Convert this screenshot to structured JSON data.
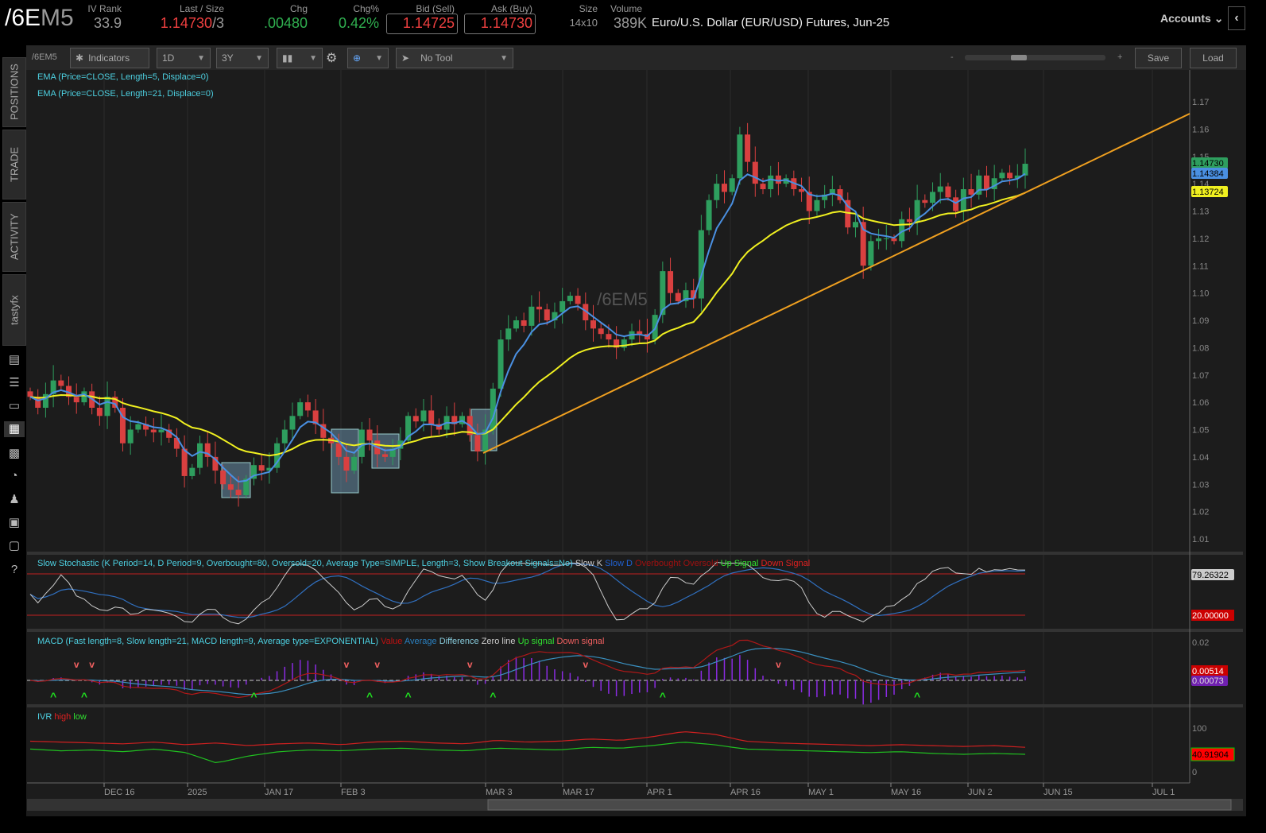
{
  "header": {
    "symbol_main": "/6E",
    "symbol_suffix": "M5",
    "iv_rank_label": "IV Rank",
    "iv_rank": "33.9",
    "last_label": "Last / Size",
    "last": "1.14730",
    "size": "/3",
    "chg_label": "Chg",
    "chg": ".00480",
    "chgpct_label": "Chg%",
    "chgpct": "0.42%",
    "bid_label": "Bid (Sell)",
    "bid": "1.14725",
    "ask_label": "Ask (Buy)",
    "ask": "1.14730",
    "size_label": "Size",
    "size_val": "14x10",
    "volume_label": "Volume",
    "volume": "389K",
    "description": "Euro/U.S. Dollar (EUR/USD) Futures, Jun-25",
    "accounts": "Accounts"
  },
  "sidebar": {
    "tabs": [
      "POSITIONS",
      "TRADE",
      "ACTIVITY",
      "tastyfx"
    ]
  },
  "toolbar": {
    "symbol": "/6EM5",
    "indicators": "Indicators",
    "interval": "1D",
    "range": "3Y",
    "tool": "No Tool",
    "zoom_minus": "-",
    "zoom_plus": "+",
    "save": "Save",
    "load": "Load"
  },
  "studies": {
    "ema5": "EMA (Price=CLOSE, Length=5, Displace=0)",
    "ema21": "EMA (Price=CLOSE, Length=21, Displace=0)",
    "stoch": {
      "title": "Slow Stochastic (K Period=14, D Period=9, Overbought=80, Oversold=20, Average Type=SIMPLE, Length=3, Show Breakout Signals=No)",
      "k": "Slow K",
      "d": "Slow D",
      "ob": "Overbought",
      "os": "Oversold",
      "up": "Up Signal",
      "down": "Down Signal",
      "value": "79.26322",
      "oversold_value": "20.00000"
    },
    "macd": {
      "title": "MACD (Fast length=8, Slow length=21, MACD length=9, Average type=EXPONENTIAL)",
      "value": "Value",
      "avg": "Average",
      "diff": "Difference",
      "zero": "Zero line",
      "up": "Up signal",
      "down": "Down signal",
      "val": "0.00514",
      "diffval": "0.00073",
      "tick": "0.02"
    },
    "ivr": {
      "title": "IVR",
      "high": "high",
      "low": "low",
      "val": "40.91904",
      "t100": "100",
      "t0": "0"
    }
  },
  "price_tags": {
    "last": "1.14730",
    "ema5": "1.14384",
    "ema21": "1.13724"
  },
  "watermark": "/6EM5",
  "chart_data": {
    "type": "candlestick",
    "symbol": "/6EM5",
    "first_date": "Dec 2",
    "last_date": "Jun 10",
    "closes": [
      1.062,
      1.058,
      1.063,
      1.068,
      1.066,
      1.062,
      1.06,
      1.064,
      1.058,
      1.055,
      1.062,
      1.058,
      1.045,
      1.05,
      1.052,
      1.05,
      1.049,
      1.05,
      1.047,
      1.043,
      1.033,
      1.036,
      1.045,
      1.04,
      1.035,
      1.03,
      1.028,
      1.026,
      1.032,
      1.037,
      1.035,
      1.036,
      1.045,
      1.05,
      1.055,
      1.06,
      1.057,
      1.052,
      1.047,
      1.045,
      1.04,
      1.035,
      1.04,
      1.05,
      1.046,
      1.041,
      1.04,
      1.043,
      1.046,
      1.055,
      1.053,
      1.057,
      1.052,
      1.05,
      1.055,
      1.052,
      1.055,
      1.048,
      1.042,
      1.05,
      1.065,
      1.083,
      1.087,
      1.09,
      1.088,
      1.095,
      1.094,
      1.09,
      1.093,
      1.097,
      1.099,
      1.096,
      1.09,
      1.087,
      1.085,
      1.083,
      1.08,
      1.083,
      1.086,
      1.085,
      1.083,
      1.092,
      1.108,
      1.1,
      1.097,
      1.101,
      1.098,
      1.123,
      1.134,
      1.14,
      1.137,
      1.142,
      1.158,
      1.148,
      1.14,
      1.138,
      1.143,
      1.14,
      1.142,
      1.138,
      1.137,
      1.13,
      1.134,
      1.136,
      1.138,
      1.134,
      1.124,
      1.126,
      1.11,
      1.119,
      1.12,
      1.12,
      1.119,
      1.127,
      1.126,
      1.134,
      1.133,
      1.137,
      1.139,
      1.135,
      1.13,
      1.138,
      1.136,
      1.143,
      1.138,
      1.142,
      1.144,
      1.142,
      1.143,
      1.1473
    ],
    "y_ticks": [
      "1.17",
      "1.16",
      "1.15",
      "1.14",
      "1.13",
      "1.12",
      "1.11",
      "1.10",
      "1.09",
      "1.08",
      "1.07",
      "1.06",
      "1.05",
      "1.04",
      "1.03",
      "1.02",
      "1.01"
    ],
    "x_ticks": [
      "DEC 16",
      "2025",
      "JAN 17",
      "FEB 3",
      "MAR 3",
      "MAR 17",
      "APR 1",
      "APR 16",
      "MAY 1",
      "MAY 16",
      "JUN 2",
      "JUN 15",
      "JUL 1"
    ],
    "ylim": [
      1.0,
      1.18
    ],
    "trendline": {
      "from": [
        "Feb 28",
        1.042
      ],
      "to": [
        "Jul 3",
        1.166
      ]
    },
    "ivr_high": [
      70,
      68,
      66,
      64,
      68,
      62,
      66,
      60,
      64,
      66,
      62,
      68,
      70,
      66,
      64,
      72,
      68,
      70,
      75,
      72,
      80,
      92,
      86,
      70,
      66,
      64,
      62,
      60,
      62,
      60,
      58,
      60,
      56
    ],
    "ivr_low": [
      52,
      48,
      50,
      46,
      52,
      44,
      20,
      36,
      46,
      50,
      48,
      52,
      54,
      50,
      48,
      54,
      52,
      50,
      56,
      54,
      60,
      68,
      62,
      52,
      50,
      48,
      46,
      44,
      46,
      42,
      40,
      42,
      40
    ],
    "colors": {
      "up": "#2e9e5e",
      "down": "#d94040",
      "ema5": "#4a90e2",
      "ema21": "#f0f020",
      "trend": "#f0a020"
    }
  }
}
